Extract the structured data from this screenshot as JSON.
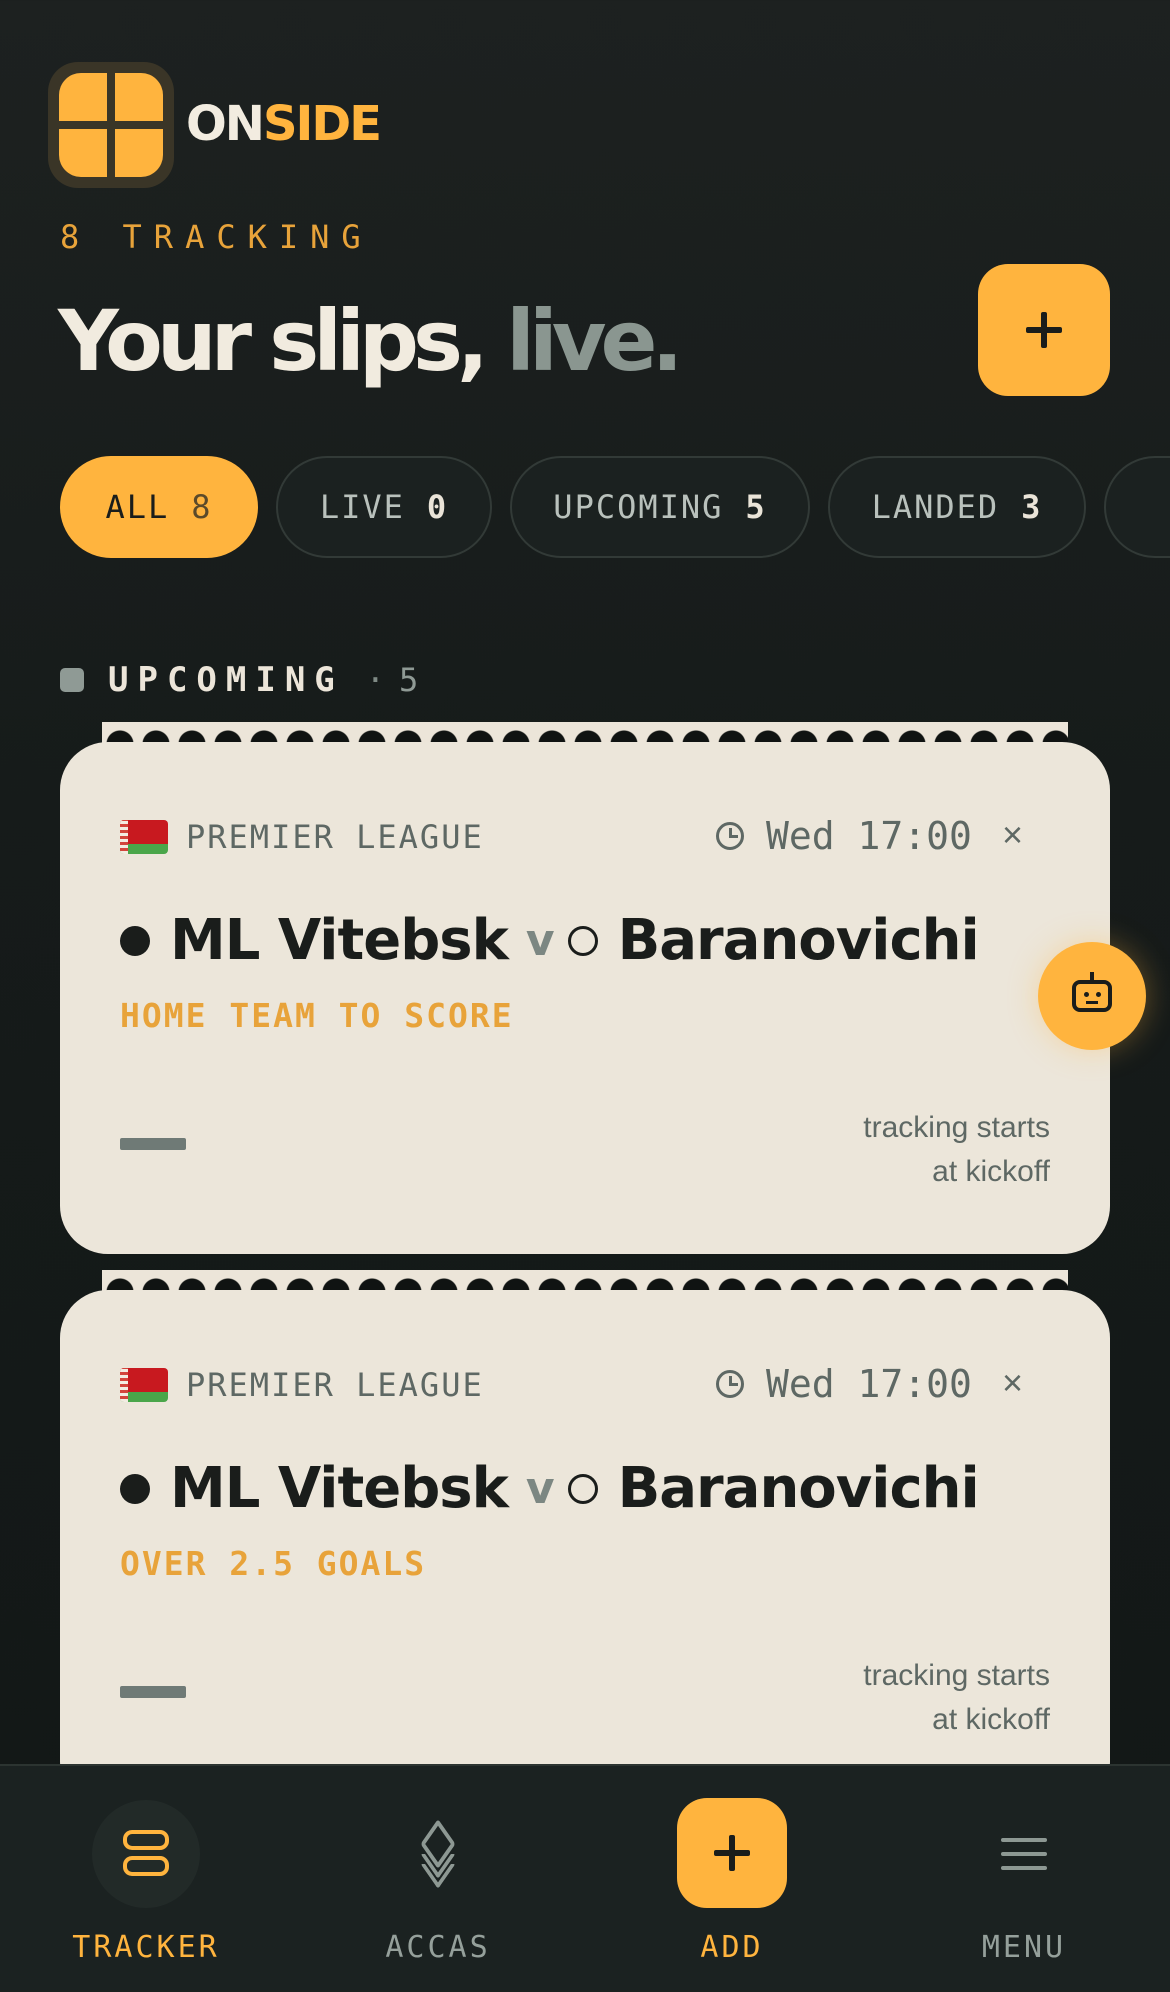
{
  "brand": {
    "part1": "ON",
    "part2": "SIDE"
  },
  "header": {
    "tracking": "8 TRACKING",
    "headline_main": "Your slips,",
    "headline_accent": "live."
  },
  "filters": [
    {
      "label": "ALL",
      "count": "8",
      "active": true
    },
    {
      "label": "LIVE",
      "count": "0",
      "active": false
    },
    {
      "label": "UPCOMING",
      "count": "5",
      "active": false
    },
    {
      "label": "LANDED",
      "count": "3",
      "active": false
    }
  ],
  "section": {
    "title": "UPCOMING",
    "separator": "·",
    "count": "5"
  },
  "cards": [
    {
      "league": "PREMIER LEAGUE",
      "time": "Wed 17:00",
      "home": "ML Vitebsk",
      "vs": "v",
      "away": "Baranovichi",
      "pick": "HOME TEAM TO SCORE",
      "note_line1": "tracking starts",
      "note_line2": "at kickoff"
    },
    {
      "league": "PREMIER LEAGUE",
      "time": "Wed 17:00",
      "home": "ML Vitebsk",
      "vs": "v",
      "away": "Baranovichi",
      "pick": "OVER 2.5 GOALS",
      "note_line1": "tracking starts",
      "note_line2": "at kickoff"
    }
  ],
  "close_symbol": "×",
  "nav": {
    "tracker": "TRACKER",
    "accas": "ACCAS",
    "add": "ADD",
    "menu": "MENU"
  },
  "colors": {
    "accent": "#ffb43e",
    "background": "#161b1a",
    "card": "#ece6da",
    "pick": "#e8a33a"
  },
  "icons": [
    "logo-icon",
    "plus-icon",
    "clock-icon",
    "close-icon",
    "robot-icon",
    "tracker-icon",
    "layers-icon",
    "menu-icon"
  ]
}
